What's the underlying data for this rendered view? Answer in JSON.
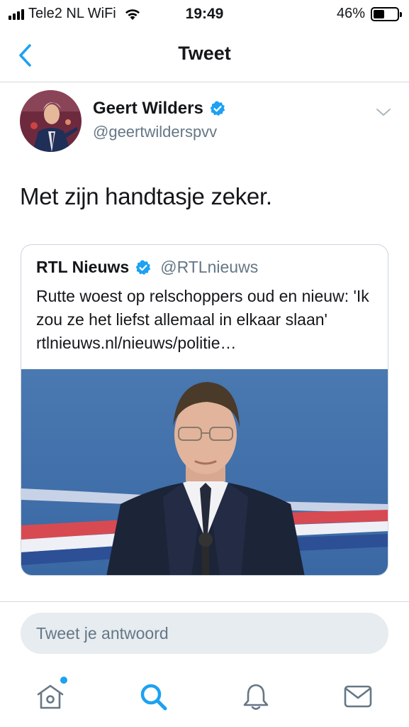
{
  "status_bar": {
    "carrier": "Tele2 NL WiFi",
    "time": "19:49",
    "battery_percent": "46%",
    "battery_level": 0.46
  },
  "nav": {
    "title": "Tweet"
  },
  "tweet": {
    "author_name": "Geert Wilders",
    "author_handle": "@geertwilderspvv",
    "verified": true,
    "text": "Met zijn handtasje zeker."
  },
  "quoted_tweet": {
    "author_name": "RTL Nieuws",
    "author_handle": "@RTLnieuws",
    "verified": true,
    "text": "Rutte woest op relschoppers oud en nieuw: 'Ik zou ze het liefst allemaal in elkaar slaan' rtlnieuws.nl/nieuws/politie…"
  },
  "reply": {
    "placeholder": "Tweet je antwoord"
  },
  "tab_bar": {
    "items": [
      {
        "icon": "home-icon",
        "has_notification": true
      },
      {
        "icon": "search-icon",
        "active": true
      },
      {
        "icon": "bell-icon"
      },
      {
        "icon": "mail-icon"
      }
    ]
  },
  "colors": {
    "accent": "#1da1f2",
    "text": "#14171a",
    "secondary_text": "#657786",
    "border": "#ccd6dd",
    "reply_bg": "#e6ecf0"
  }
}
